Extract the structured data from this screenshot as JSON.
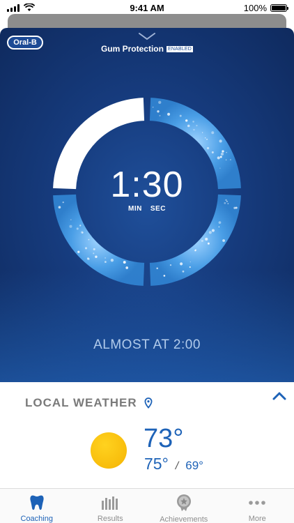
{
  "status_bar": {
    "time": "9:41 AM",
    "battery": "100%",
    "battery_level": 1.0
  },
  "brand": {
    "logo_text": "Oral-B"
  },
  "mode": {
    "title": "Gum Protection",
    "badge": "ENABLED"
  },
  "timer": {
    "value": "1:30",
    "unit_min": "MIN",
    "unit_sec": "SEC",
    "quadrants_done": 3,
    "quadrants_total": 4
  },
  "status_message": "ALMOST AT 2:00",
  "weather": {
    "title": "LOCAL WEATHER",
    "current": "73°",
    "high": "75°",
    "separator": "/",
    "low": "69°",
    "condition_icon": "sun-icon"
  },
  "tabs": [
    {
      "label": "Coaching",
      "icon": "tooth-icon",
      "active": true
    },
    {
      "label": "Results",
      "icon": "bar-chart-icon",
      "active": false
    },
    {
      "label": "Achievements",
      "icon": "medal-icon",
      "active": false
    },
    {
      "label": "More",
      "icon": "more-dots-icon",
      "active": false
    }
  ],
  "colors": {
    "panel": "#163b7d",
    "accent": "#1d62b7",
    "ring_done": "#4a9ee6",
    "ring_pending": "#ffffff"
  }
}
